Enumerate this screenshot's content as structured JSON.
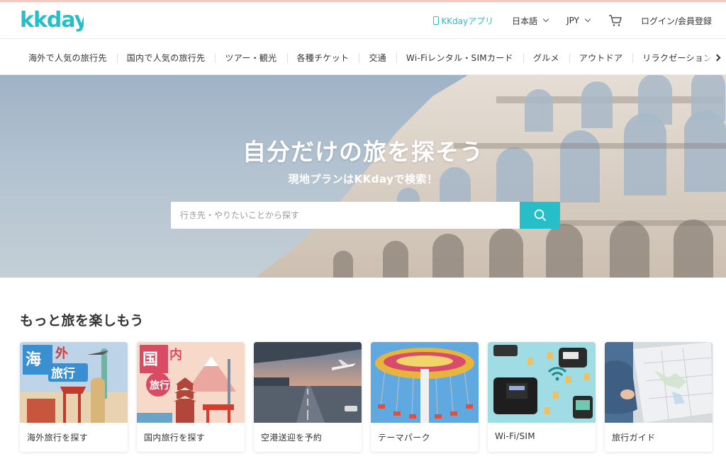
{
  "brand": {
    "logo_text": "kkday",
    "accent": "#26bec9"
  },
  "header": {
    "app_label": "KKdayアプリ",
    "language": "日本語",
    "currency": "JPY",
    "login_label": "ログイン/会員登録"
  },
  "nav": {
    "items": [
      "海外で人気の旅行先",
      "国内で人気の旅行先",
      "ツアー・観光",
      "各種チケット",
      "交通",
      "Wi-Fiレンタル・SIMカード",
      "グルメ",
      "アウトドア",
      "リラクゼーション"
    ]
  },
  "hero": {
    "title": "自分だけの旅を探そう",
    "subtitle": "現地プランはKKdayで検索！",
    "search_placeholder": "行き先・やりたいことから探す"
  },
  "section": {
    "title": "もっと旅を楽しもう",
    "cards": [
      {
        "label": "海外旅行を探す",
        "badge": "海外旅行"
      },
      {
        "label": "国内旅行を探す",
        "badge": "国内旅行"
      },
      {
        "label": "空港送迎を予約"
      },
      {
        "label": "テーマパーク"
      },
      {
        "label": "Wi-Fi/SIM"
      },
      {
        "label": "旅行ガイド"
      }
    ]
  }
}
